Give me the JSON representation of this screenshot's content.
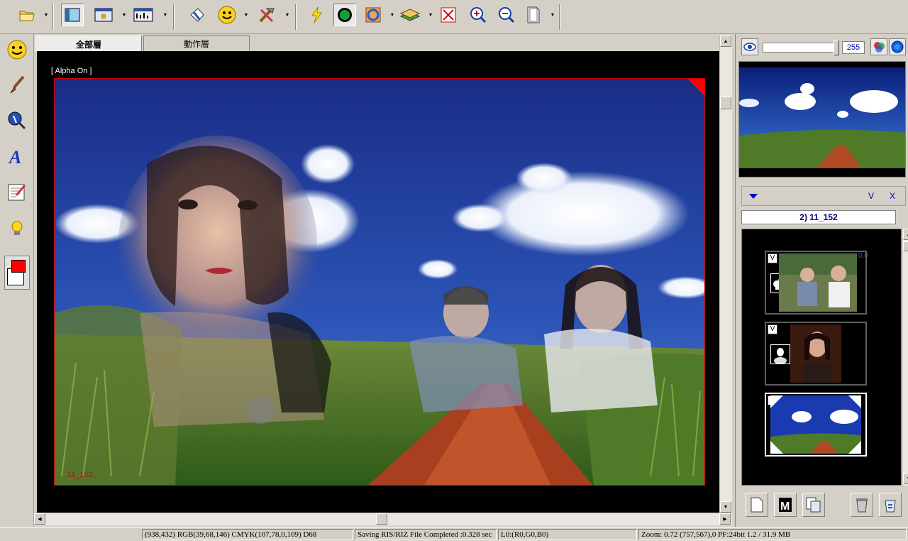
{
  "tabs": [
    {
      "label": "全部層"
    },
    {
      "label": "動作層"
    }
  ],
  "canvas": {
    "alpha_label": "[ Alpha On ]",
    "image_caption": "11_152"
  },
  "right_panel": {
    "opacity_value": "255",
    "layer_header_v": "V",
    "layer_header_x": "X",
    "current_layer": "2) 11_152",
    "layers": [
      {
        "check": "V",
        "badge": "0.0"
      },
      {
        "check": "V"
      },
      {
        "check": "V"
      }
    ]
  },
  "status": {
    "cursor": "(938,432) RGB(39,68,146) CMYK(107,78,0,109) D68",
    "message": "Saving RIS/RIZ File Completed :0.328 sec",
    "layer_info": "L0:(R0,G0,B0)",
    "zoom": "Zoom: 0.72  (757,567),0 PF:24bit  1.2 / 31.9 MB"
  },
  "icons": {
    "toolbar": [
      "folder-open-icon",
      "panel-toggle-icon",
      "canvas-size-icon",
      "levels-icon",
      "select-arrow-icon",
      "smiley-icon",
      "tools-icon",
      "lightning-icon",
      "circle-icon",
      "ring-icon",
      "layers-stack-icon",
      "fit-window-icon",
      "zoom-in-icon",
      "zoom-out-icon",
      "page-icon"
    ],
    "left": [
      "smiley-icon",
      "brush-icon",
      "stamp-icon",
      "text-icon",
      "edit-document-icon",
      "light-bulb-icon"
    ]
  },
  "colors": {
    "foreground": "#ff0000",
    "background": "#ffffff",
    "accent_blue": "#0000c0"
  }
}
